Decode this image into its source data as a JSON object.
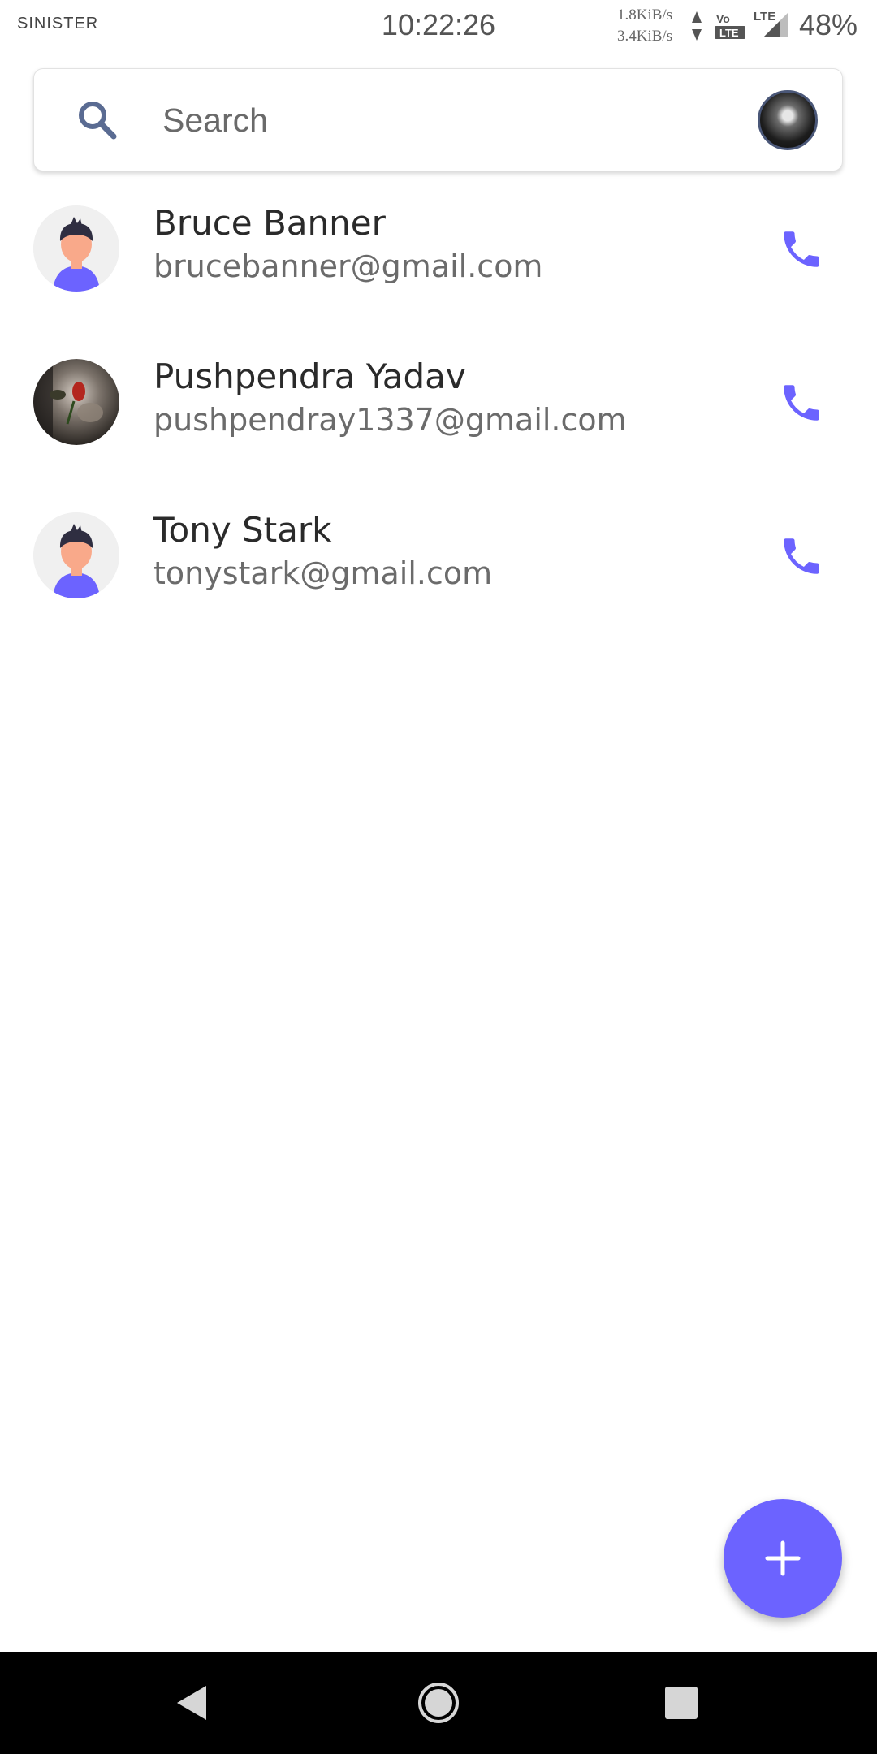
{
  "status_bar": {
    "carrier": "SINISTER",
    "time": "10:22:26",
    "upload_speed": "1.8KiB/s",
    "download_speed": "3.4KiB/s",
    "network": "LTE",
    "battery": "48%"
  },
  "search": {
    "placeholder": "Search",
    "icon": "search-icon"
  },
  "contacts": [
    {
      "name": "Bruce Banner",
      "email": "brucebanner@gmail.com",
      "avatar": "default-person-avatar"
    },
    {
      "name": "Pushpendra Yadav",
      "email": "pushpendray1337@gmail.com",
      "avatar": "photo-avatar"
    },
    {
      "name": "Tony Stark",
      "email": "tonystark@gmail.com",
      "avatar": "default-person-avatar"
    }
  ],
  "fab": {
    "icon": "plus-icon"
  },
  "colors": {
    "accent": "#6c63ff",
    "text_primary": "#2a2a2a",
    "text_secondary": "#6b6b6b",
    "search_icon": "#5a6b92"
  }
}
